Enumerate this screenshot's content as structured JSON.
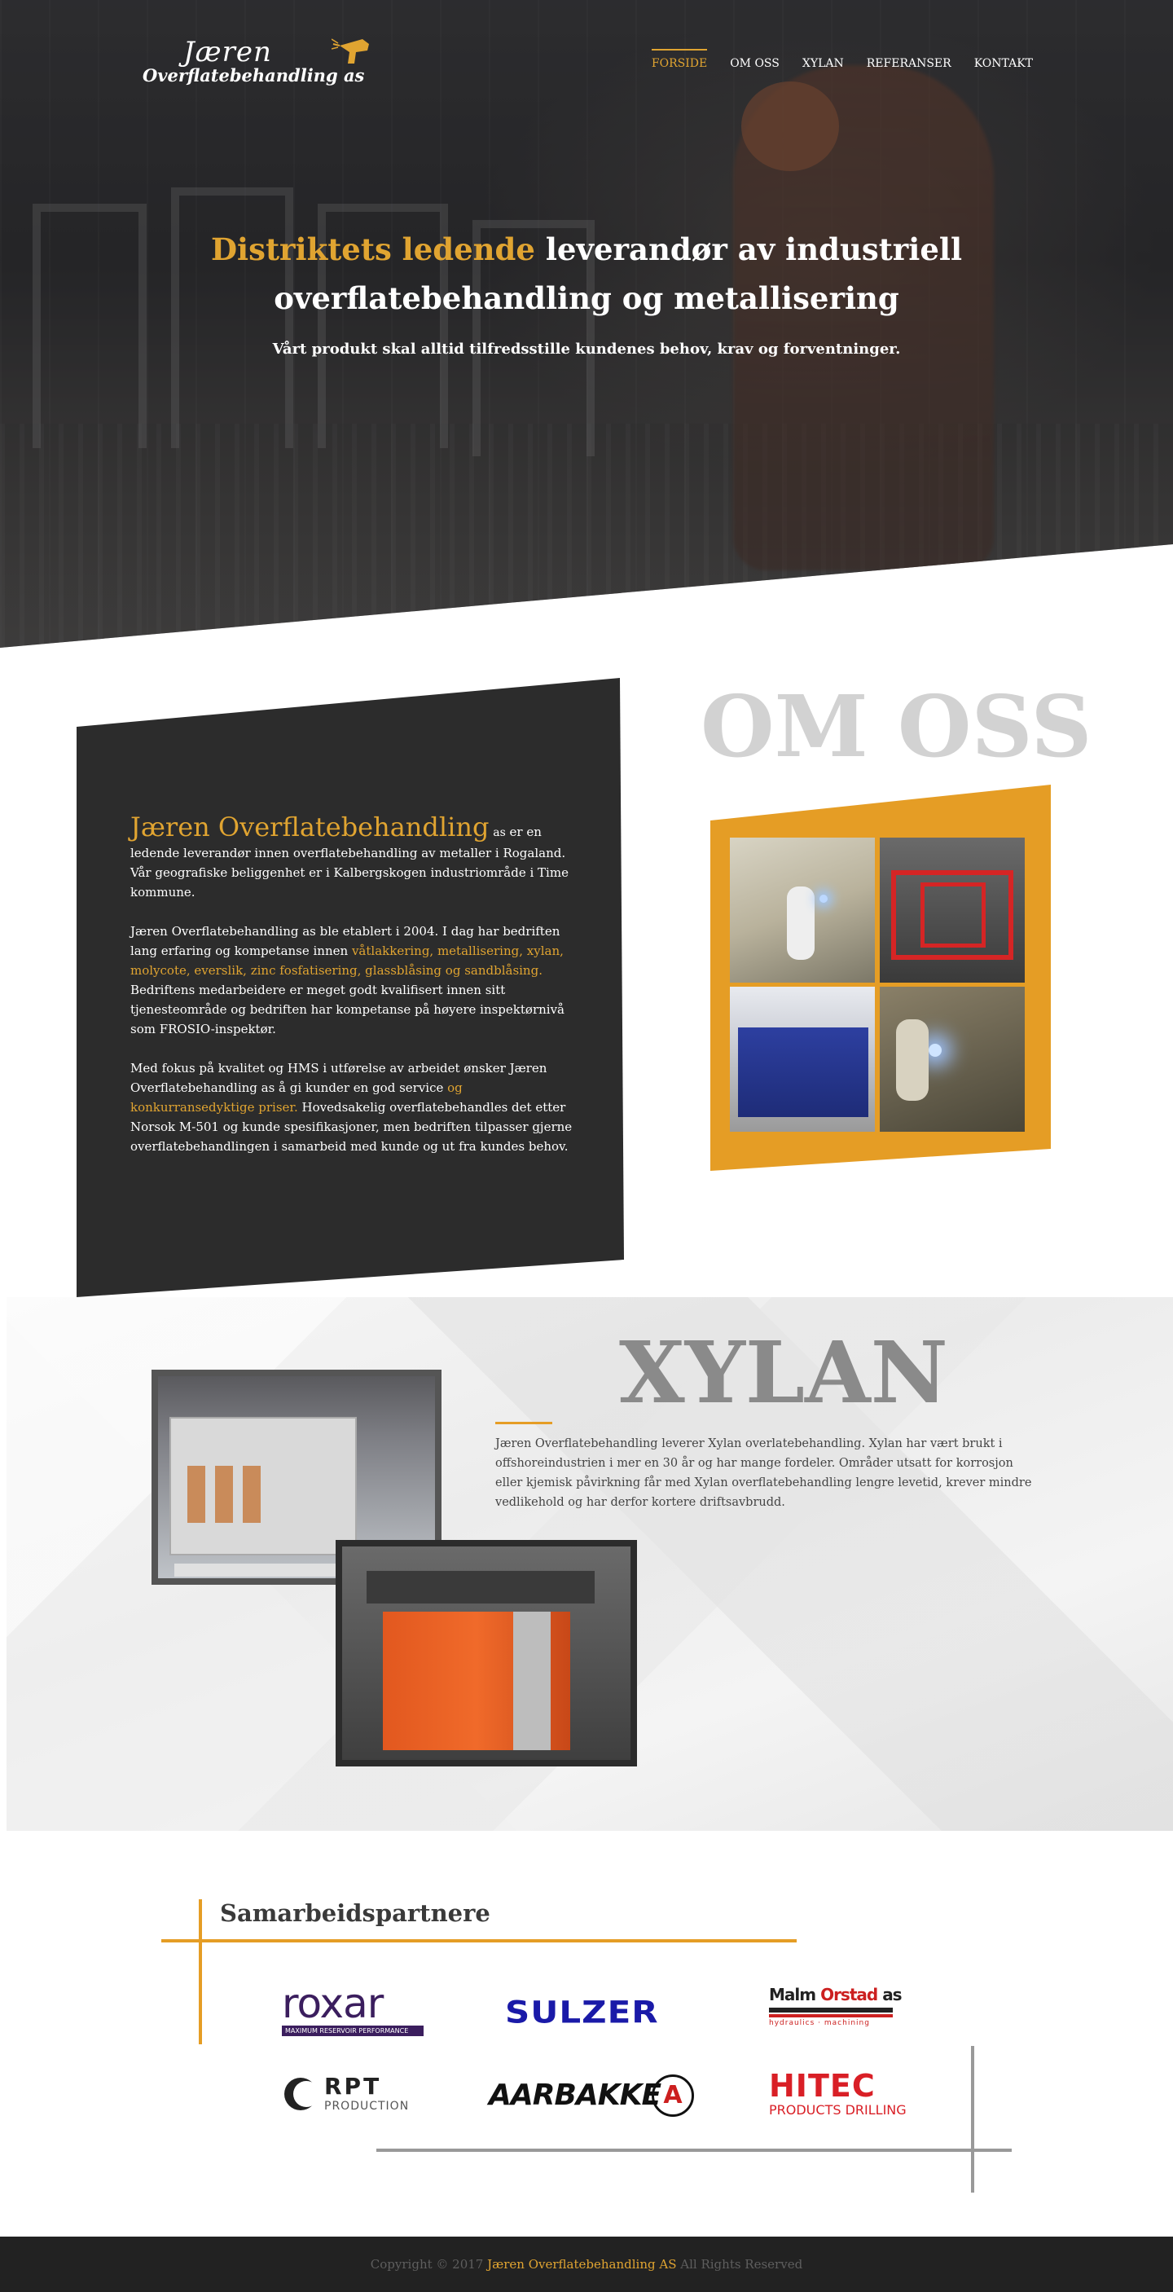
{
  "brand": {
    "logo_line1": "Jæren",
    "logo_line2": "Overflatebehandling as"
  },
  "nav": {
    "items": [
      {
        "label": "FORSIDE",
        "active": true
      },
      {
        "label": "OM OSS",
        "active": false
      },
      {
        "label": "XYLAN",
        "active": false
      },
      {
        "label": "REFERANSER",
        "active": false
      },
      {
        "label": "KONTAKT",
        "active": false
      }
    ]
  },
  "hero": {
    "title_accent": "Distriktets ledende",
    "title_rest": "leverandør av industriell",
    "title_line2": "overflatebehandling og metallisering",
    "subtitle": "Vårt produkt skal alltid tilfredsstille kundenes behov, krav og forventninger."
  },
  "about": {
    "heading": "OM OSS",
    "company_name": "Jæren Overflatebehandling",
    "p1_as": "as",
    "p1_rest": "er en ledende leverandør innen overflatebehandling av metaller i Rogaland. Vår geografiske beliggenhet er i Kalbergskogen industriområde i Time kommune.",
    "p2_a": "Jæren Overflatebehandling as ble etablert i 2004. I dag har bedriften lang erfaring og kompetanse innen",
    "p2_highlight": "våtlakkering, metallisering, xylan, molycote, everslik, zinc fosfatisering, glassblåsing og sandblåsing.",
    "p2_b": "Bedriftens medarbeidere er meget godt kvalifisert innen sitt tjenesteområde og bedriften har kompetanse på høyere inspektørnivå som FROSIO-inspektør.",
    "p3_a": "Med fokus på kvalitet og HMS i utførelse av arbeidet ønsker Jæren Overflatebehandling as å gi kunder en god service",
    "p3_highlight": "og konkurransedyktige priser.",
    "p3_b": "Hovedsakelig overflatebehandles det etter Norsok M-501 og kunde spesifikasjoner, men bedriften tilpasser gjerne overflatebehandlingen i samarbeid med kunde og ut fra kundes behov."
  },
  "xylan": {
    "heading": "XYLAN",
    "text": "Jæren Overflatebehandling leverer Xylan overlatebehandling. Xylan har vært brukt i offshoreindustrien i mer en 30 år og har mange fordeler. Områder utsatt for korrosjon eller kjemisk påvirkning får med Xylan overflatebehandling lengre levetid, krever mindre vedlikehold og har derfor kortere driftsavbrudd."
  },
  "partners": {
    "heading": "Samarbeidspartnere",
    "logos": [
      {
        "name": "roxar",
        "text": "roxar",
        "tagline": "MAXIMUM RESERVOIR PERFORMANCE"
      },
      {
        "name": "sulzer",
        "text": "SULZER"
      },
      {
        "name": "malm-orstad",
        "text_a": "Malm",
        "text_b": "Orstad",
        "text_c": "as",
        "tagline": "hydraulics · machining"
      },
      {
        "name": "rpt",
        "text": "RPT",
        "tagline": "PRODUCTION"
      },
      {
        "name": "aarbakke",
        "text": "AARBAKKE",
        "mark": "A"
      },
      {
        "name": "hitec",
        "text": "HITEC",
        "tagline": "PRODUCTS DRILLING"
      }
    ]
  },
  "footer": {
    "prefix": "Copyright © 2017",
    "brand": "Jæren Overflatebehandling AS",
    "suffix": "All Rights Reserved"
  },
  "colors": {
    "accent": "#e0a431",
    "dark": "#2c2c2c",
    "footer_bg": "#222222"
  }
}
